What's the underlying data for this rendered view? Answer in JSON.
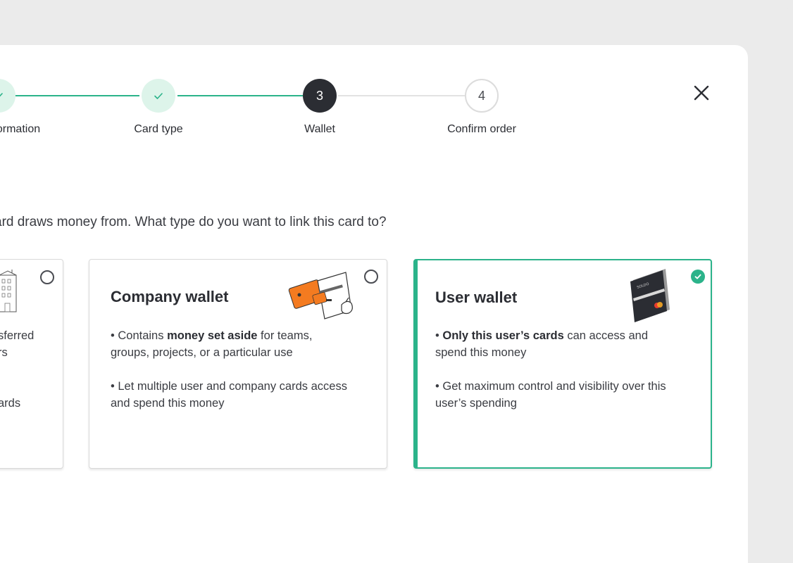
{
  "stepper": {
    "steps": [
      {
        "label": "Information",
        "state": "done",
        "display": "ormation"
      },
      {
        "label": "Card type",
        "state": "done"
      },
      {
        "label": "Wallet",
        "state": "current",
        "number": "3"
      },
      {
        "label": "Confirm order",
        "state": "todo",
        "number": "4"
      }
    ]
  },
  "question": "ard draws money from. What type do you want to link this card to?",
  "cards": {
    "left": {
      "line1": "sferred",
      "line2": "rs",
      "line3": "ards"
    },
    "company": {
      "title": "Company wallet",
      "bullet1_prefix": "• Contains ",
      "bullet1_bold": "money set aside",
      "bullet1_suffix": " for teams, groups, projects, or a particular use",
      "bullet2": "• Let multiple user and company cards access and spend this money"
    },
    "user": {
      "title": "User wallet",
      "bullet1_prefix": "• ",
      "bullet1_bold": "Only this user’s cards",
      "bullet1_suffix": " can access and spend this money",
      "bullet2": "• Get maximum control and visibility over this user’s spending",
      "card_brand": "SOLDO"
    }
  },
  "colors": {
    "accent": "#2bb38a",
    "dark": "#2b2d33",
    "orange": "#f47b20"
  }
}
